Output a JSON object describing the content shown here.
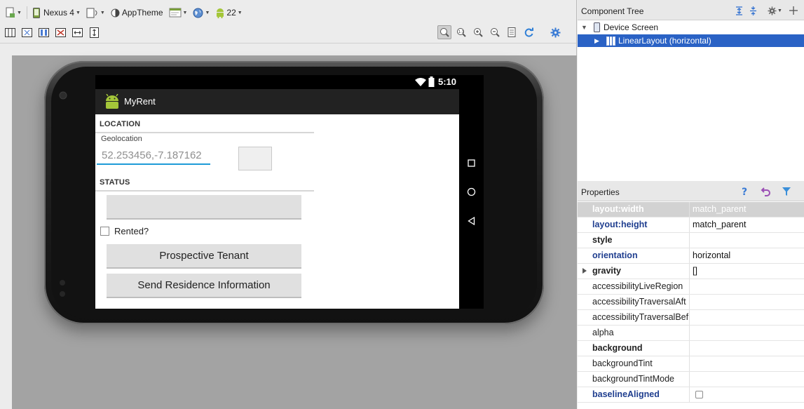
{
  "toolbar": {
    "device": "Nexus 4",
    "theme": "AppTheme",
    "api_level": "22"
  },
  "phone": {
    "status_time": "5:10",
    "app_name": "MyRent",
    "location_header": "LOCATION",
    "geolocation_label": "Geolocation",
    "geolocation_value": "52.253456,-7.187162",
    "status_header": "STATUS",
    "date_button_label": "",
    "rented_label": "Rented?",
    "tenant_button_label": "Prospective Tenant",
    "send_button_label": "Send Residence Information"
  },
  "component_tree": {
    "title": "Component Tree",
    "items": [
      {
        "label": "Device Screen"
      },
      {
        "label": "LinearLayout (horizontal)"
      }
    ]
  },
  "properties": {
    "title": "Properties",
    "rows": [
      {
        "name": "layout:width",
        "value": "match_parent"
      },
      {
        "name": "layout:height",
        "value": "match_parent"
      },
      {
        "name": "style",
        "value": ""
      },
      {
        "name": "orientation",
        "value": "horizontal"
      },
      {
        "name": "gravity",
        "value": "[]"
      },
      {
        "name": "accessibilityLiveRegion",
        "value": ""
      },
      {
        "name": "accessibilityTraversalAft",
        "value": ""
      },
      {
        "name": "accessibilityTraversalBef",
        "value": ""
      },
      {
        "name": "alpha",
        "value": ""
      },
      {
        "name": "background",
        "value": ""
      },
      {
        "name": "backgroundTint",
        "value": ""
      },
      {
        "name": "backgroundTintMode",
        "value": ""
      },
      {
        "name": "baselineAligned",
        "value": ""
      }
    ]
  },
  "colors": {
    "selection": "#2a62c5",
    "property_link": "#1f3e8f",
    "android_green": "#a4c639",
    "input_underline": "#1e9bd7"
  }
}
